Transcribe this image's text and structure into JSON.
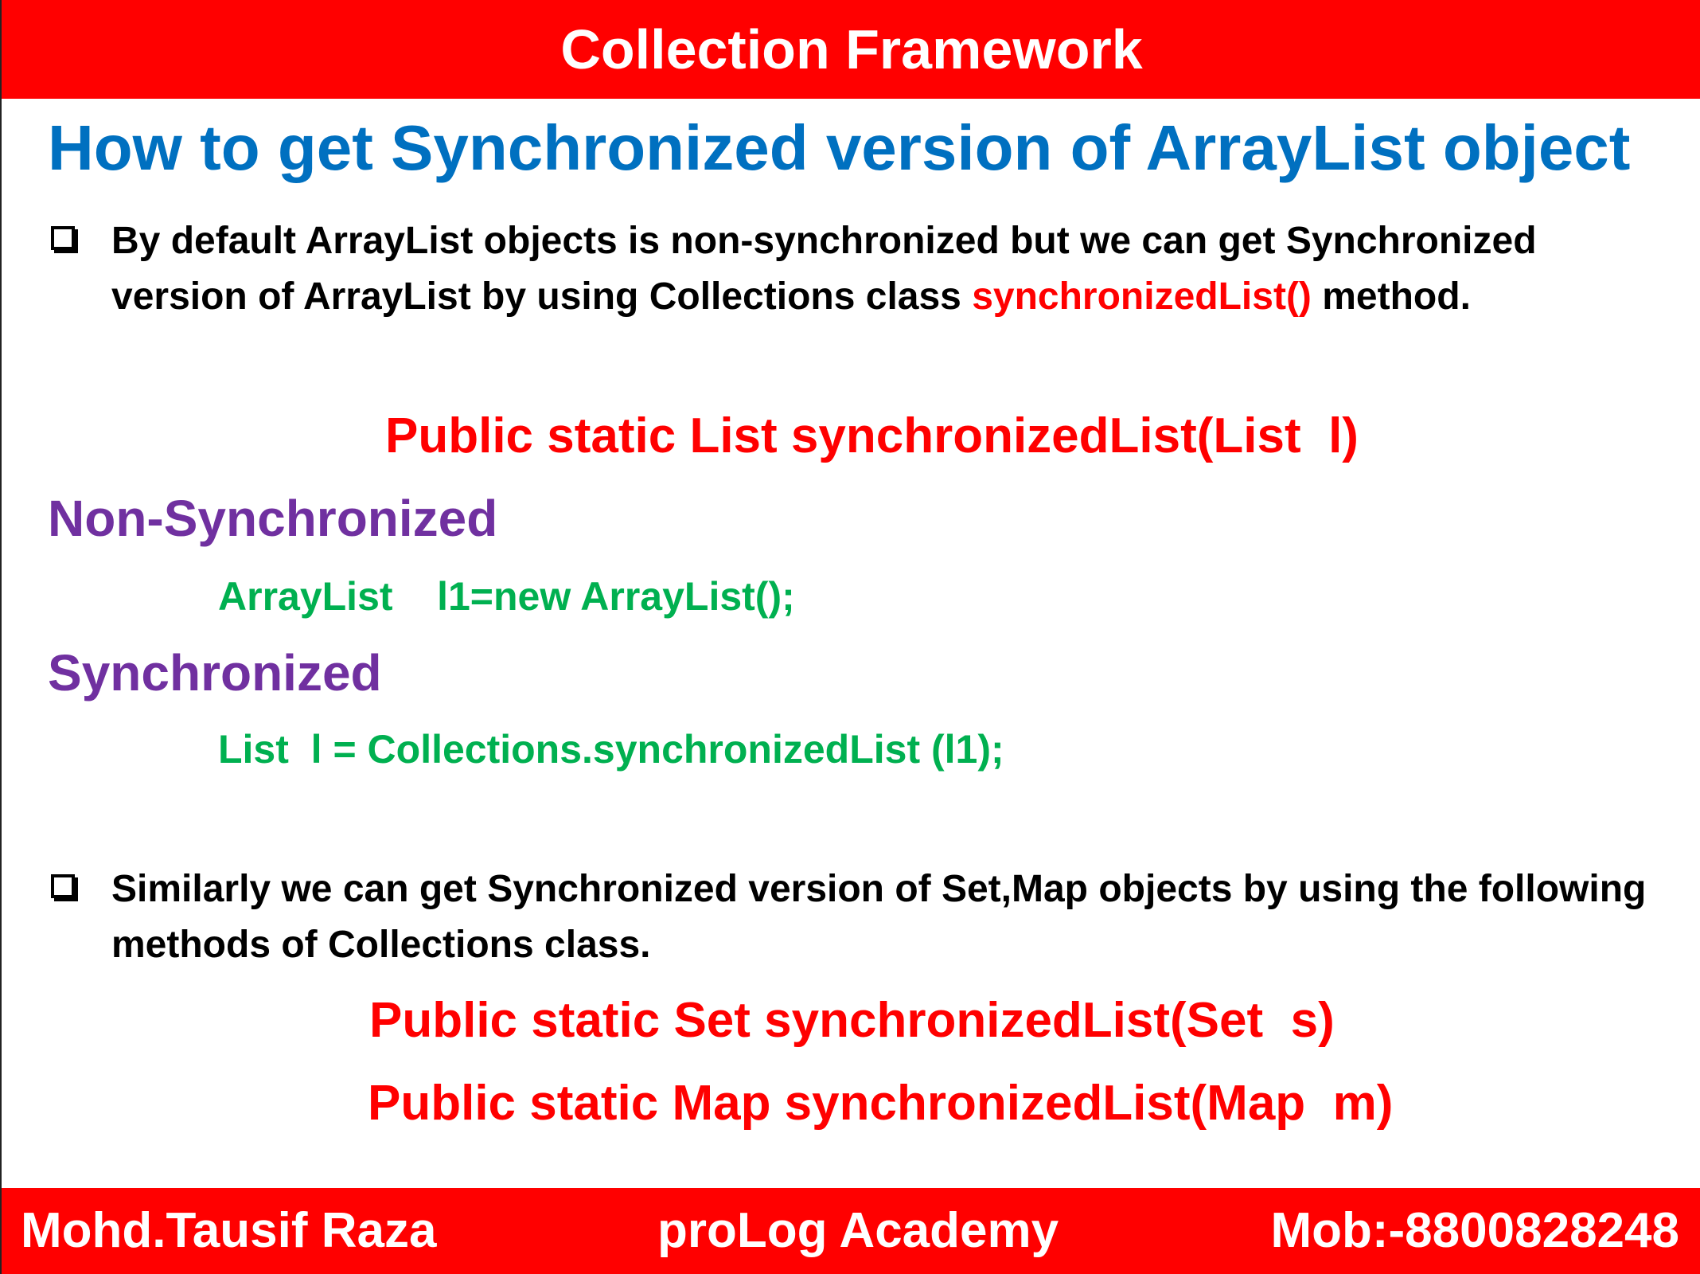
{
  "header": {
    "title": "Collection Framework"
  },
  "title": "How to get Synchronized version of ArrayList object",
  "bullet1": {
    "text_before": "By default ArrayList objects is non-synchronized but we can get Synchronized version of ArrayList by using Collections class ",
    "highlight": "synchronizedList()",
    "text_after": " method."
  },
  "signature1": "Public static List synchronizedList(List  l)",
  "non_sync": {
    "heading": "Non-Synchronized",
    "code": "ArrayList    l1=new ArrayList();"
  },
  "sync": {
    "heading": "Synchronized",
    "code": "List  l = Collections.synchronizedList (l1);"
  },
  "bullet2": {
    "text": "Similarly we can get Synchronized version of Set,Map objects by using the following methods of Collections class."
  },
  "signature2": "Public static Set synchronizedList(Set  s)",
  "signature3": "Public static Map synchronizedList(Map  m)",
  "footer": {
    "author": "Mohd.Tausif Raza",
    "academy": "proLog Academy",
    "mobile": "Mob:-8800828248"
  },
  "colors": {
    "header_bg": "#ff0000",
    "title": "#0070c0",
    "heading": "#7030a0",
    "code": "#00b050",
    "highlight": "#ff0000"
  }
}
